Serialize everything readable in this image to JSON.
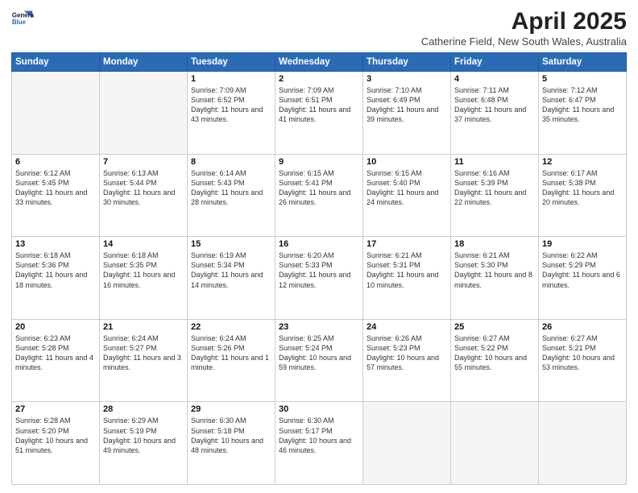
{
  "header": {
    "logo_line1": "General",
    "logo_line2": "Blue",
    "title": "April 2025",
    "subtitle": "Catherine Field, New South Wales, Australia"
  },
  "weekdays": [
    "Sunday",
    "Monday",
    "Tuesday",
    "Wednesday",
    "Thursday",
    "Friday",
    "Saturday"
  ],
  "weeks": [
    [
      {
        "day": "",
        "info": ""
      },
      {
        "day": "",
        "info": ""
      },
      {
        "day": "1",
        "info": "Sunrise: 7:09 AM\nSunset: 6:52 PM\nDaylight: 11 hours and 43 minutes."
      },
      {
        "day": "2",
        "info": "Sunrise: 7:09 AM\nSunset: 6:51 PM\nDaylight: 11 hours and 41 minutes."
      },
      {
        "day": "3",
        "info": "Sunrise: 7:10 AM\nSunset: 6:49 PM\nDaylight: 11 hours and 39 minutes."
      },
      {
        "day": "4",
        "info": "Sunrise: 7:11 AM\nSunset: 6:48 PM\nDaylight: 11 hours and 37 minutes."
      },
      {
        "day": "5",
        "info": "Sunrise: 7:12 AM\nSunset: 6:47 PM\nDaylight: 11 hours and 35 minutes."
      }
    ],
    [
      {
        "day": "6",
        "info": "Sunrise: 6:12 AM\nSunset: 5:45 PM\nDaylight: 11 hours and 33 minutes."
      },
      {
        "day": "7",
        "info": "Sunrise: 6:13 AM\nSunset: 5:44 PM\nDaylight: 11 hours and 30 minutes."
      },
      {
        "day": "8",
        "info": "Sunrise: 6:14 AM\nSunset: 5:43 PM\nDaylight: 11 hours and 28 minutes."
      },
      {
        "day": "9",
        "info": "Sunrise: 6:15 AM\nSunset: 5:41 PM\nDaylight: 11 hours and 26 minutes."
      },
      {
        "day": "10",
        "info": "Sunrise: 6:15 AM\nSunset: 5:40 PM\nDaylight: 11 hours and 24 minutes."
      },
      {
        "day": "11",
        "info": "Sunrise: 6:16 AM\nSunset: 5:39 PM\nDaylight: 11 hours and 22 minutes."
      },
      {
        "day": "12",
        "info": "Sunrise: 6:17 AM\nSunset: 5:38 PM\nDaylight: 11 hours and 20 minutes."
      }
    ],
    [
      {
        "day": "13",
        "info": "Sunrise: 6:18 AM\nSunset: 5:36 PM\nDaylight: 11 hours and 18 minutes."
      },
      {
        "day": "14",
        "info": "Sunrise: 6:18 AM\nSunset: 5:35 PM\nDaylight: 11 hours and 16 minutes."
      },
      {
        "day": "15",
        "info": "Sunrise: 6:19 AM\nSunset: 5:34 PM\nDaylight: 11 hours and 14 minutes."
      },
      {
        "day": "16",
        "info": "Sunrise: 6:20 AM\nSunset: 5:33 PM\nDaylight: 11 hours and 12 minutes."
      },
      {
        "day": "17",
        "info": "Sunrise: 6:21 AM\nSunset: 5:31 PM\nDaylight: 11 hours and 10 minutes."
      },
      {
        "day": "18",
        "info": "Sunrise: 6:21 AM\nSunset: 5:30 PM\nDaylight: 11 hours and 8 minutes."
      },
      {
        "day": "19",
        "info": "Sunrise: 6:22 AM\nSunset: 5:29 PM\nDaylight: 11 hours and 6 minutes."
      }
    ],
    [
      {
        "day": "20",
        "info": "Sunrise: 6:23 AM\nSunset: 5:28 PM\nDaylight: 11 hours and 4 minutes."
      },
      {
        "day": "21",
        "info": "Sunrise: 6:24 AM\nSunset: 5:27 PM\nDaylight: 11 hours and 3 minutes."
      },
      {
        "day": "22",
        "info": "Sunrise: 6:24 AM\nSunset: 5:26 PM\nDaylight: 11 hours and 1 minute."
      },
      {
        "day": "23",
        "info": "Sunrise: 6:25 AM\nSunset: 5:24 PM\nDaylight: 10 hours and 59 minutes."
      },
      {
        "day": "24",
        "info": "Sunrise: 6:26 AM\nSunset: 5:23 PM\nDaylight: 10 hours and 57 minutes."
      },
      {
        "day": "25",
        "info": "Sunrise: 6:27 AM\nSunset: 5:22 PM\nDaylight: 10 hours and 55 minutes."
      },
      {
        "day": "26",
        "info": "Sunrise: 6:27 AM\nSunset: 5:21 PM\nDaylight: 10 hours and 53 minutes."
      }
    ],
    [
      {
        "day": "27",
        "info": "Sunrise: 6:28 AM\nSunset: 5:20 PM\nDaylight: 10 hours and 51 minutes."
      },
      {
        "day": "28",
        "info": "Sunrise: 6:29 AM\nSunset: 5:19 PM\nDaylight: 10 hours and 49 minutes."
      },
      {
        "day": "29",
        "info": "Sunrise: 6:30 AM\nSunset: 5:18 PM\nDaylight: 10 hours and 48 minutes."
      },
      {
        "day": "30",
        "info": "Sunrise: 6:30 AM\nSunset: 5:17 PM\nDaylight: 10 hours and 46 minutes."
      },
      {
        "day": "",
        "info": ""
      },
      {
        "day": "",
        "info": ""
      },
      {
        "day": "",
        "info": ""
      }
    ]
  ]
}
